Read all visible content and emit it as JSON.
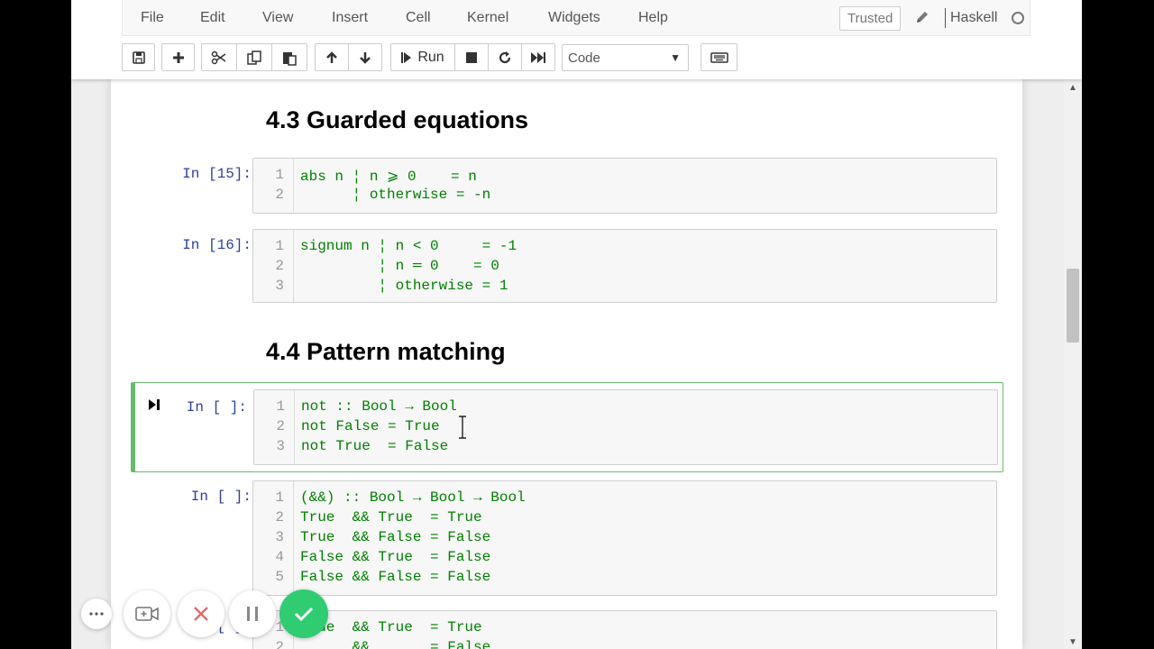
{
  "menubar": {
    "items": [
      "File",
      "Edit",
      "View",
      "Insert",
      "Cell",
      "Kernel",
      "Widgets",
      "Help"
    ],
    "trusted_label": "Trusted",
    "kernel_name": "Haskell"
  },
  "toolbar": {
    "run_label": "Run",
    "cell_type": "Code",
    "buttons": [
      "save-icon",
      "plus-icon",
      "scissors-icon",
      "copy-icon",
      "paste-icon",
      "arrow-up-icon",
      "arrow-down-icon",
      "step-icon",
      "stop-icon",
      "restart-icon",
      "fast-forward-icon",
      "keyboard-icon"
    ]
  },
  "notebook": {
    "headings": [
      "4.3 Guarded equations",
      "4.4 Pattern matching"
    ],
    "cells": [
      {
        "prompt": "In [15]:",
        "lines": [
          "abs n ¦ n ⩾ 0    = n",
          "      ¦ otherwise = -n"
        ]
      },
      {
        "prompt": "In [16]:",
        "lines": [
          "signum n ¦ n < 0     = -1",
          "         ¦ n ═ 0    = 0",
          "         ¦ otherwise = 1"
        ]
      },
      {
        "prompt": "In [ ]:",
        "lines": [
          "not :: Bool → Bool",
          "not False = True",
          "not True  = False"
        ]
      },
      {
        "prompt": "In [ ]:",
        "lines": [
          "(&&) :: Bool → Bool → Bool",
          "True  && True  = True",
          "True  && False = False",
          "False && True  = False",
          "False && False = False"
        ]
      },
      {
        "prompt": "In [ ]:",
        "lines": [
          "True  && True  = True",
          "      &&       = False"
        ]
      }
    ],
    "line_numbers": [
      "1",
      "2",
      "3",
      "4",
      "5"
    ]
  },
  "overlay": {
    "buttons": [
      "more-icon",
      "camera-icon",
      "close-icon",
      "pause-icon",
      "check-icon"
    ]
  }
}
